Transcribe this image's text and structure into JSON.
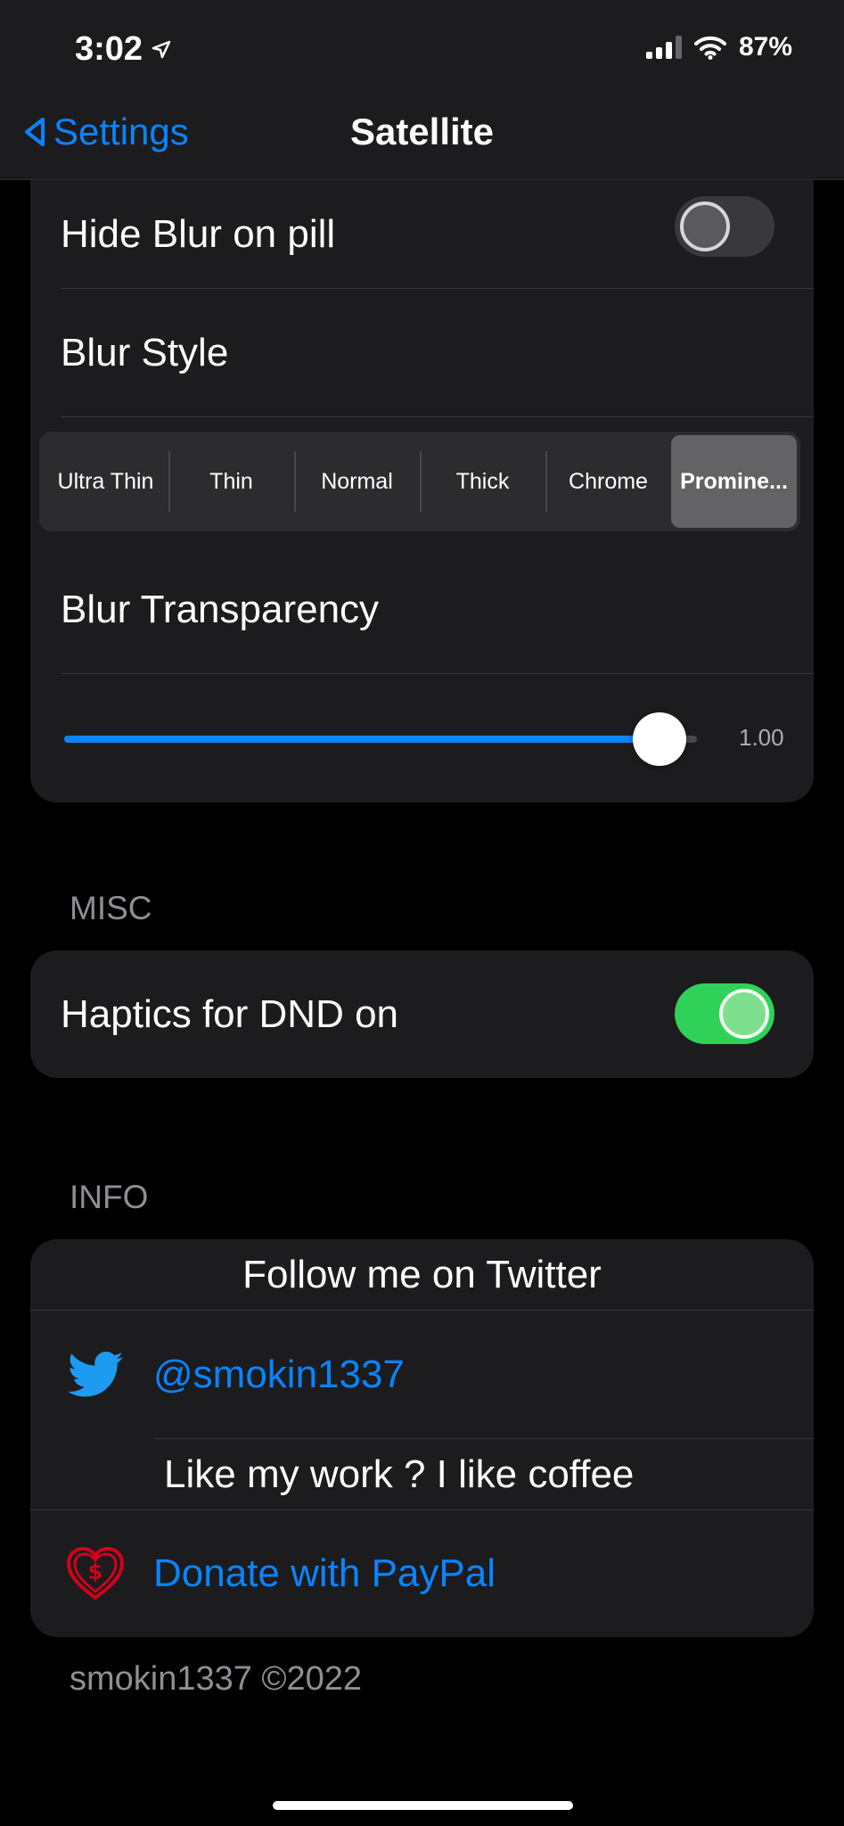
{
  "status_bar": {
    "time": "3:02",
    "battery": "87%",
    "location_icon": "location-arrow-icon",
    "signal_icon": "cellular-signal-icon",
    "wifi_icon": "wifi-icon"
  },
  "nav": {
    "back_label": "Settings",
    "title": "Satellite"
  },
  "blur_card": {
    "hide_blur_label": "Hide Blur on pill",
    "hide_blur_on": false,
    "blur_style_label": "Blur Style",
    "blur_styles": [
      "Ultra Thin",
      "Thin",
      "Normal",
      "Thick",
      "Chrome",
      "Promine..."
    ],
    "selected_style_index": 5,
    "blur_transparency_label": "Blur Transparency",
    "transparency_value": 1.0,
    "transparency_text": "1.00"
  },
  "misc": {
    "header": "MISC",
    "haptics_label": "Haptics for DND on",
    "haptics_on": true
  },
  "info": {
    "header": "INFO",
    "twitter_heading": "Follow me on Twitter",
    "twitter_handle": "@smokin1337",
    "coffee_heading": "Like my work ? I like coffee",
    "donate_label": "Donate with PayPal"
  },
  "footer": "smokin1337 ©2022",
  "colors": {
    "accent": "#0a84ff",
    "toggle_on": "#30d158",
    "card": "#1c1c1e",
    "background": "#000000"
  }
}
